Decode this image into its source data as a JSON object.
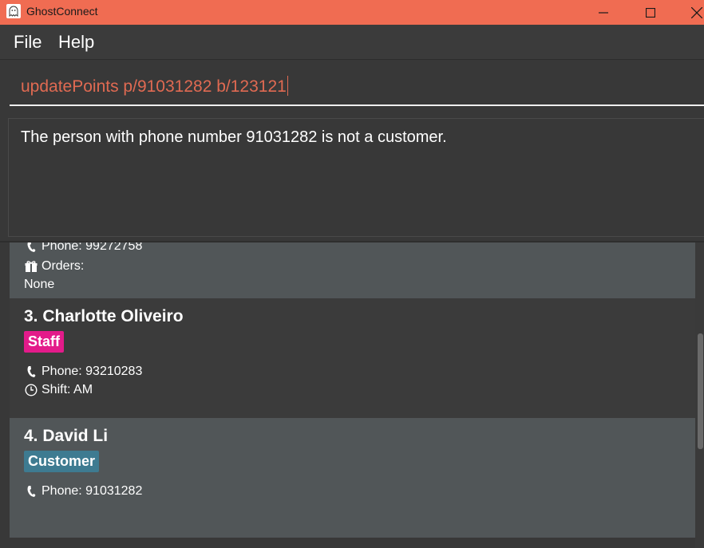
{
  "window": {
    "title": "GhostConnect"
  },
  "menu": {
    "file": "File",
    "help": "Help"
  },
  "command": {
    "value": "updatePoints p/91031282 b/123121"
  },
  "result": {
    "message": "The person with phone number 91031282 is not a customer."
  },
  "persons": {
    "partial": {
      "phone": "Phone: 99272758",
      "orders_label": "Orders:",
      "orders_value": "None"
    },
    "p3": {
      "name": "3. Charlotte Oliveiro",
      "tag": "Staff",
      "phone": "Phone: 93210283",
      "shift": "Shift: AM"
    },
    "p4": {
      "name": "4. David Li",
      "tag": "Customer",
      "phone": "Phone: 91031282"
    }
  },
  "colors": {
    "titlebar": "#f06c52",
    "command_text": "#e06a52",
    "staff_tag": "#e31b8a",
    "customer_tag": "#3e7b91"
  }
}
